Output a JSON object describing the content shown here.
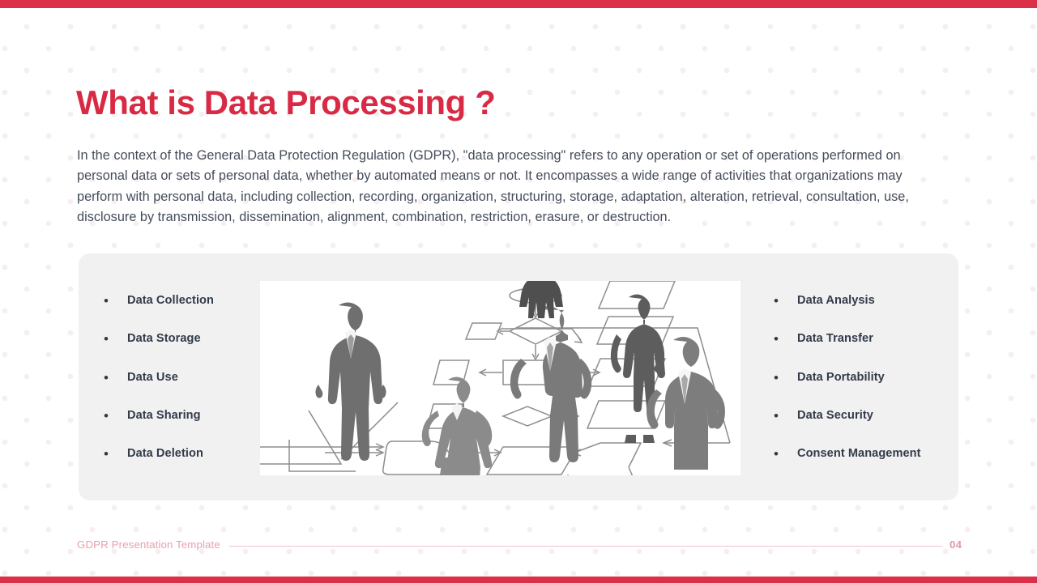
{
  "slide": {
    "title": "What is Data Processing ?",
    "paragraph": "In the context of the General Data Protection Regulation (GDPR), \"data processing\" refers to any operation or set of operations performed on personal data or sets of personal data, whether by automated means or not. It encompasses a wide range of activities that organizations may perform with personal data, including collection, recording, organization, structuring, storage, adaptation, alteration, retrieval, consultation, use, disclosure by transmission, dissemination, alignment, combination, restriction, erasure, or destruction."
  },
  "panel": {
    "bullet_marker": "•",
    "left_column": [
      {
        "label": "Data Collection"
      },
      {
        "label": "Data Storage"
      },
      {
        "label": "Data Use"
      },
      {
        "label": "Data Sharing"
      },
      {
        "label": "Data Deletion"
      }
    ],
    "right_column": [
      {
        "label": "Data Analysis"
      },
      {
        "label": "Data Transfer"
      },
      {
        "label": "Data Portability"
      },
      {
        "label": "Data Security"
      },
      {
        "label": "Consent Management"
      }
    ],
    "illustration": {
      "name": "business-people-flowchart-illustration",
      "description": "Grayscale silhouettes of business people standing on a 3D process flowchart"
    }
  },
  "footer": {
    "label": "GDPR Presentation Template",
    "page_number": "04"
  },
  "colors": {
    "accent_red": "#dc3048",
    "title_red": "#d82a44",
    "body_text": "#444c5a",
    "bullet_text": "#333b49",
    "panel_background": "#f1f1f2",
    "footer_text": "#e8a0ad",
    "dot_pattern": "#f6eef0",
    "illustration_figure": "#6e6e6e",
    "illustration_line": "#8a8a8a"
  }
}
